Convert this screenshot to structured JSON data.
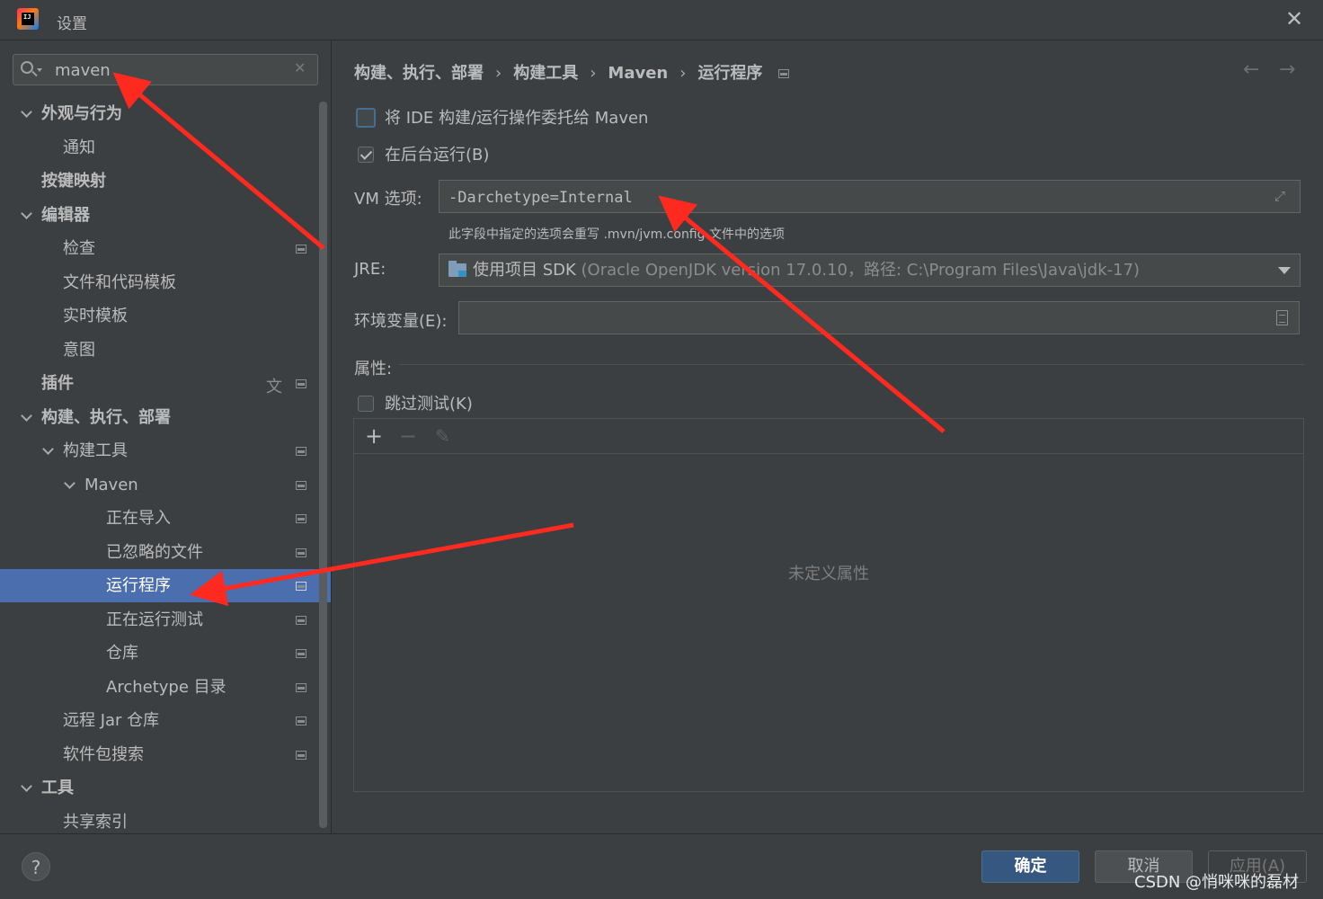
{
  "window": {
    "title": "设置",
    "close_glyph": "✕"
  },
  "search": {
    "value": "maven",
    "clear_glyph": "✕"
  },
  "tree": [
    {
      "label": "外观与行为",
      "bold": true
    },
    {
      "label": "通知"
    },
    {
      "label": "按键映射",
      "bold": true
    },
    {
      "label": "编辑器",
      "bold": true
    },
    {
      "label": "检查"
    },
    {
      "label": "文件和代码模板"
    },
    {
      "label": "实时模板"
    },
    {
      "label": "意图"
    },
    {
      "label": "插件",
      "bold": true
    },
    {
      "label": "构建、执行、部署",
      "bold": true
    },
    {
      "label": "构建工具"
    },
    {
      "label": "Maven"
    },
    {
      "label": "正在导入"
    },
    {
      "label": "已忽略的文件"
    },
    {
      "label": "运行程序",
      "selected": true
    },
    {
      "label": "正在运行测试"
    },
    {
      "label": "仓库"
    },
    {
      "label": "Archetype 目录"
    },
    {
      "label": "远程 Jar 仓库"
    },
    {
      "label": "软件包搜索"
    },
    {
      "label": "工具",
      "bold": true
    },
    {
      "label": "共享索引"
    }
  ],
  "breadcrumb": {
    "items": [
      "构建、执行、部署",
      "构建工具",
      "Maven",
      "运行程序"
    ],
    "separator": "›"
  },
  "nav": {
    "back": "←",
    "forward": "→"
  },
  "runner": {
    "delegate_label": "将 IDE 构建/运行操作委托给 Maven",
    "delegate_checked": false,
    "background_label": "在后台运行(B)",
    "background_checked": true,
    "vm_label": "VM 选项:",
    "vm_value": "-Darchetype=Internal",
    "vm_hint": "此字段中指定的选项会重写 .mvn/jvm.config 文件中的选项",
    "jre_label": "JRE:",
    "jre_main": "使用项目 SDK",
    "jre_detail": " (Oracle OpenJDK version 17.0.10，路径: C:\\Program Files\\Java\\jdk-17)",
    "env_label": "环境变量(E):",
    "env_value": "",
    "props_label": "属性:",
    "skip_tests_label": "跳过测试(K)",
    "skip_tests_checked": false,
    "empty_props_text": "未定义属性",
    "toolbar": {
      "add": "+",
      "remove": "−",
      "edit": "✎"
    }
  },
  "footer": {
    "help": "?",
    "ok": "确定",
    "cancel": "取消",
    "apply": "应用(A)",
    "watermark": "CSDN @悄咪咪的磊材"
  },
  "colors": {
    "selection": "#4b6eaf",
    "annotation_arrow": "#ff2a1f",
    "ok_button": "#365880"
  }
}
